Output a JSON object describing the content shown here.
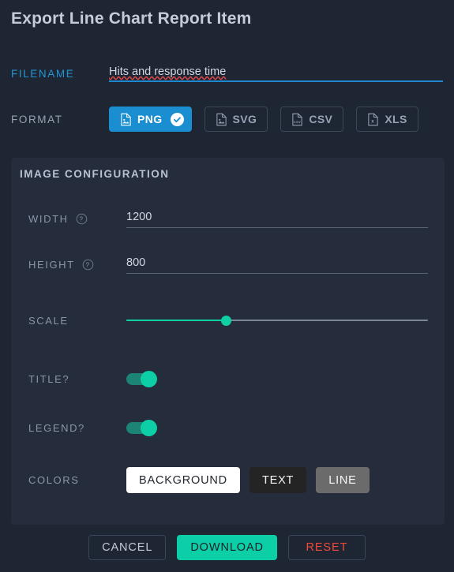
{
  "dialog": {
    "title": "Export Line Chart Report Item"
  },
  "filename": {
    "label": "FILENAME",
    "value": "Hits and response time",
    "placeholder": "Hits and response time"
  },
  "format": {
    "label": "FORMAT",
    "options": [
      {
        "label": "PNG",
        "icon": "file-image-icon",
        "selected": true
      },
      {
        "label": "SVG",
        "icon": "file-image-icon",
        "selected": false
      },
      {
        "label": "CSV",
        "icon": "file-csv-icon",
        "selected": false
      },
      {
        "label": "XLS",
        "icon": "file-excel-icon",
        "selected": false
      }
    ],
    "selected_badge_icon": "check-circle-icon"
  },
  "image_configuration": {
    "title": "IMAGE CONFIGURATION",
    "width": {
      "label": "WIDTH",
      "value": "1200",
      "help_icon": "help-circle-icon"
    },
    "height": {
      "label": "HEIGHT",
      "value": "800",
      "help_icon": "help-circle-icon"
    },
    "scale": {
      "label": "SCALE",
      "percent": 33
    },
    "title_toggle": {
      "label": "TITLE?",
      "on": true
    },
    "legend_toggle": {
      "label": "LEGEND?",
      "on": true
    },
    "colors": {
      "label": "COLORS",
      "chips": [
        {
          "label": "BACKGROUND",
          "swatch": "#ffffff",
          "text": "#22272e"
        },
        {
          "label": "TEXT",
          "swatch": "#242424",
          "text": "#f2f2f2"
        },
        {
          "label": "LINE",
          "swatch": "#6b6b6b",
          "text": "#f7f7f7"
        }
      ]
    }
  },
  "footer": {
    "cancel": "CANCEL",
    "download": "DOWNLOAD",
    "reset": "RESET"
  },
  "theme": {
    "background": "#1e2533",
    "panel": "#252c3c",
    "accent_blue": "#1a8ed1",
    "accent_teal": "#0ccfa7",
    "danger_red": "#f4483c",
    "label_muted": "#8b95a8"
  }
}
